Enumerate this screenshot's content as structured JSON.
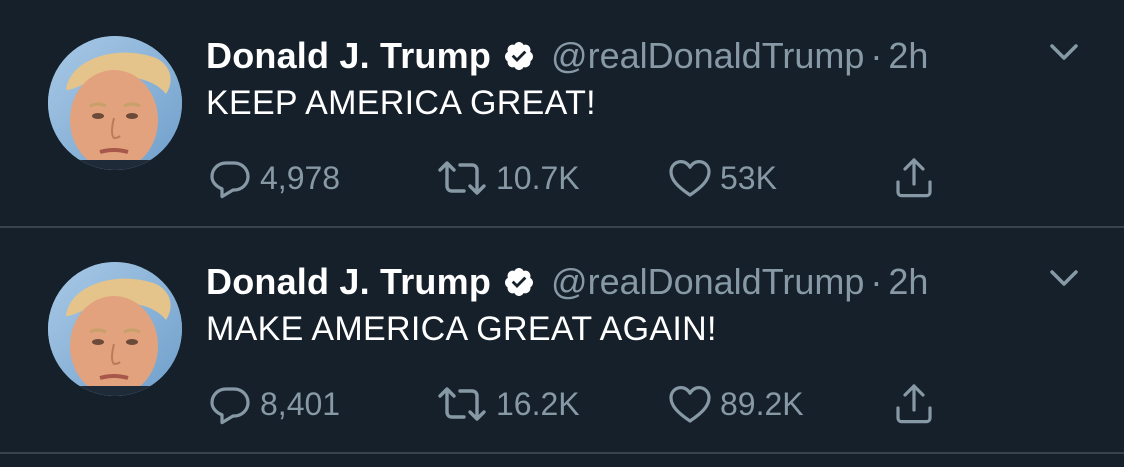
{
  "tweets": [
    {
      "author_name": "Donald J. Trump",
      "handle": "@realDonaldTrump",
      "separator": "·",
      "time": "2h",
      "text": "KEEP AMERICA GREAT!",
      "reply_count": "4,978",
      "retweet_count": "10.7K",
      "like_count": "53K",
      "verified": true,
      "avatar_icon": "profile-photo",
      "icons": [
        "verified-badge-icon",
        "chevron-down-icon",
        "reply-icon",
        "retweet-icon",
        "like-icon",
        "share-icon"
      ]
    },
    {
      "author_name": "Donald J. Trump",
      "handle": "@realDonaldTrump",
      "separator": "·",
      "time": "2h",
      "text": "MAKE AMERICA GREAT AGAIN!",
      "reply_count": "8,401",
      "retweet_count": "16.2K",
      "like_count": "89.2K",
      "verified": true,
      "avatar_icon": "profile-photo",
      "icons": [
        "verified-badge-icon",
        "chevron-down-icon",
        "reply-icon",
        "retweet-icon",
        "like-icon",
        "share-icon"
      ]
    }
  ],
  "colors": {
    "background": "#15202b",
    "primary_text": "#ffffff",
    "secondary_text": "#8899a6",
    "divider": "#38444d"
  }
}
